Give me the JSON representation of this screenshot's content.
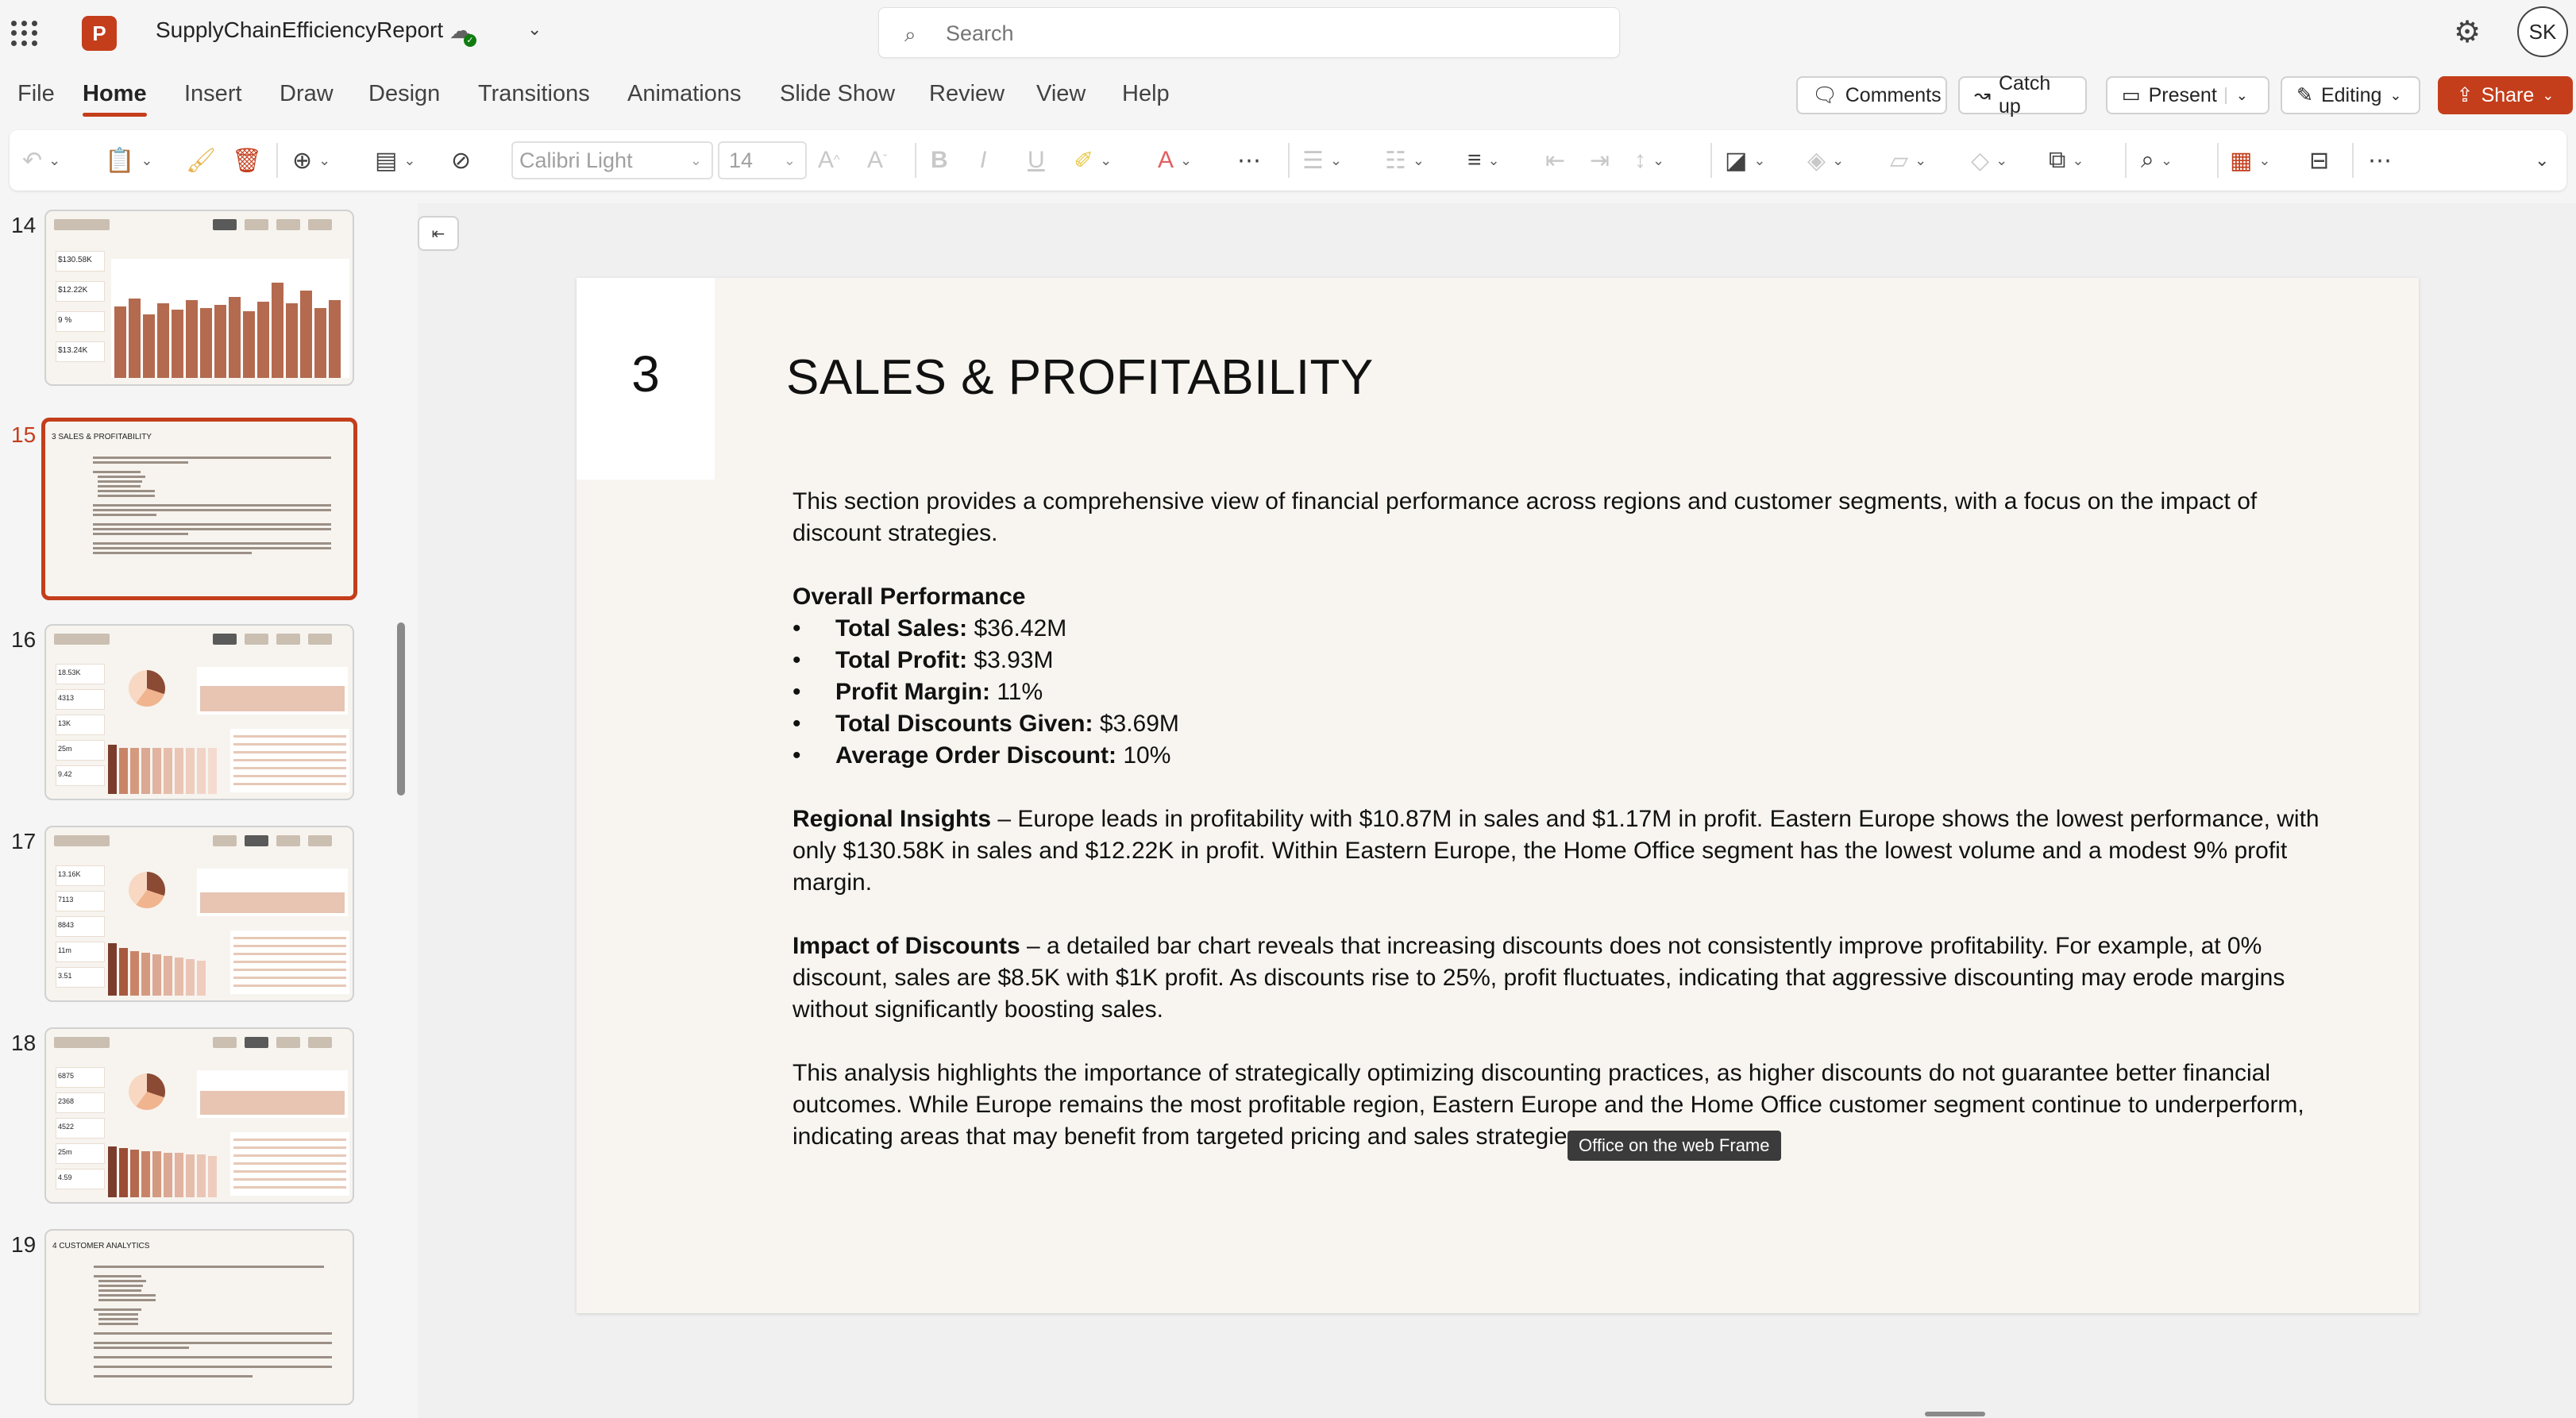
{
  "app": {
    "doc_title": "SupplyChainEfficiencyReport",
    "app_logo_letter": "P",
    "search_placeholder": "Search",
    "avatar_initials": "SK"
  },
  "menu": {
    "tabs": [
      "File",
      "Home",
      "Insert",
      "Draw",
      "Design",
      "Transitions",
      "Animations",
      "Slide Show",
      "Review",
      "View",
      "Help"
    ],
    "active_tab": "Home",
    "comments": "Comments",
    "catch_up": "Catch up",
    "present": "Present",
    "editing": "Editing",
    "share": "Share"
  },
  "ribbon": {
    "font_name": "Calibri Light",
    "font_size": "14"
  },
  "thumbnails": [
    {
      "num": "14",
      "kind": "bar-dashboard",
      "kpis": [
        "$130.58K",
        "$12.22K",
        "9 %",
        "$13.24K"
      ]
    },
    {
      "num": "15",
      "kind": "text",
      "selected": true,
      "title": "3 SALES & PROFITABILITY"
    },
    {
      "num": "16",
      "kind": "pie-dashboard",
      "kpis": [
        "18.53K",
        "4313",
        "13K",
        "25m",
        "9.42"
      ]
    },
    {
      "num": "17",
      "kind": "pie-dashboard",
      "kpis": [
        "13.16K",
        "7113",
        "8843",
        "11m",
        "3.51"
      ]
    },
    {
      "num": "18",
      "kind": "pie-dashboard",
      "kpis": [
        "6875",
        "2368",
        "4522",
        "25m",
        "4.59"
      ]
    },
    {
      "num": "19",
      "kind": "text",
      "title": "4 CUSTOMER ANALYTICS"
    }
  ],
  "slide": {
    "number": "3",
    "title": "SALES & PROFITABILITY",
    "intro": "This section provides a comprehensive view of financial performance across regions and customer segments, with a focus on the impact of discount strategies.",
    "overall_heading": "Overall Performance",
    "metrics": [
      {
        "label": "Total Sales:",
        "value": " $36.42M"
      },
      {
        "label": "Total Profit:",
        "value": " $3.93M"
      },
      {
        "label": "Profit Margin:",
        "value": " 11%"
      },
      {
        "label": "Total Discounts Given:",
        "value": " $3.69M"
      },
      {
        "label": "Average Order Discount:",
        "value": " 10%"
      }
    ],
    "regional_heading": "Regional Insights",
    "regional_text": " – Europe leads in profitability with $10.87M in sales and $1.17M in profit. Eastern Europe shows the lowest performance, with only $130.58K in sales and $12.22K in profit. Within Eastern Europe, the Home Office segment has the lowest volume and a modest 9% profit margin.",
    "discounts_heading": "Impact of Discounts",
    "discounts_text": " – a detailed bar chart reveals that increasing discounts does not consistently improve profitability. For example, at 0% discount, sales are $8.5K with $1K profit. As discounts rise to 25%, profit fluctuates, indicating that aggressive discounting may erode margins without significantly boosting sales.",
    "conclusion": "This analysis highlights the importance of strategically optimizing discounting practices, as higher discounts do not guarantee better financial outcomes. While Europe remains the most profitable region, Eastern Europe and the Home Office customer segment continue to underperform, indicating areas that may benefit from targeted pricing and sales strategies."
  },
  "tooltip": "Office on the web Frame",
  "colors": {
    "accent": "#c43e1c",
    "slide_bg": "#f8f5f0"
  }
}
